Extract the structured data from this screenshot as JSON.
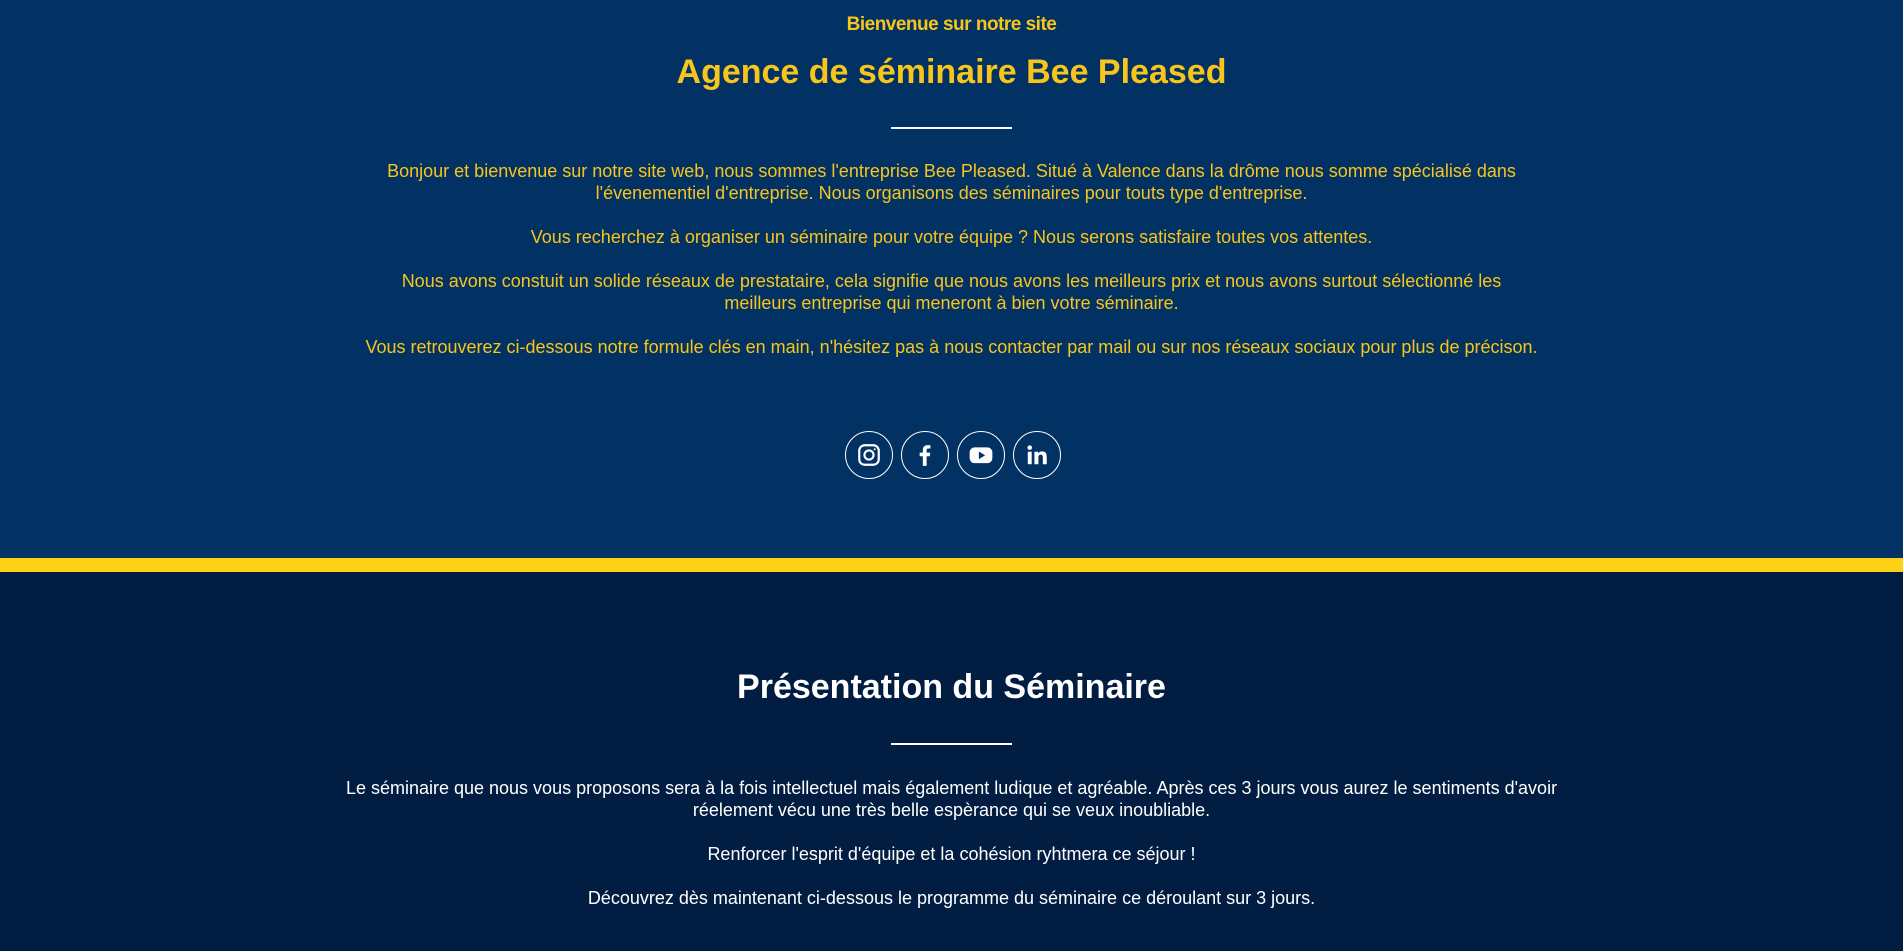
{
  "hero": {
    "eyebrow": "Bienvenue sur notre site",
    "title": "Agence de séminaire Bee Pleased",
    "paragraphs": [
      "Bonjour et bienvenue sur notre site web, nous sommes l'entreprise Bee Pleased. Situé à Valence dans la drôme nous somme spécialisé dans l'évenementiel d'entreprise. Nous organisons des séminaires pour touts type d'entreprise.",
      "Vous recherchez à organiser un séminaire pour votre équipe ? Nous serons satisfaire toutes vos attentes.",
      "Nous avons constuit un solide réseaux de prestataire, cela signifie que nous avons les meilleurs prix et nous avons surtout sélectionné les meilleurs entreprise qui meneront à bien votre séminaire.",
      "Vous retrouverez ci-dessous notre formule clés en main, n'hésitez pas à nous contacter par mail ou sur nos réseaux sociaux pour plus de précison."
    ],
    "socials": [
      {
        "icon": "instagram-icon"
      },
      {
        "icon": "facebook-icon"
      },
      {
        "icon": "youtube-icon"
      },
      {
        "icon": "linkedin-icon"
      }
    ]
  },
  "seminar": {
    "title": "Présentation du Séminaire",
    "paragraphs": [
      "Le séminaire que nous vous proposons sera à la fois intellectuel mais également ludique et agréable. Après ces 3 jours vous aurez le sentiments d'avoir réelement vécu une très belle espèrance qui se veux inoubliable.",
      "Renforcer l'esprit d'équipe et la cohésion ryhtmera ce séjour !",
      "Découvrez dès maintenant ci-dessous le programme du séminaire ce déroulant sur 3 jours."
    ]
  },
  "colors": {
    "hero_bg": "#023263",
    "section_bg": "#011d41",
    "accent_yellow": "#f8c51c",
    "stripe_yellow": "#fdd114"
  }
}
